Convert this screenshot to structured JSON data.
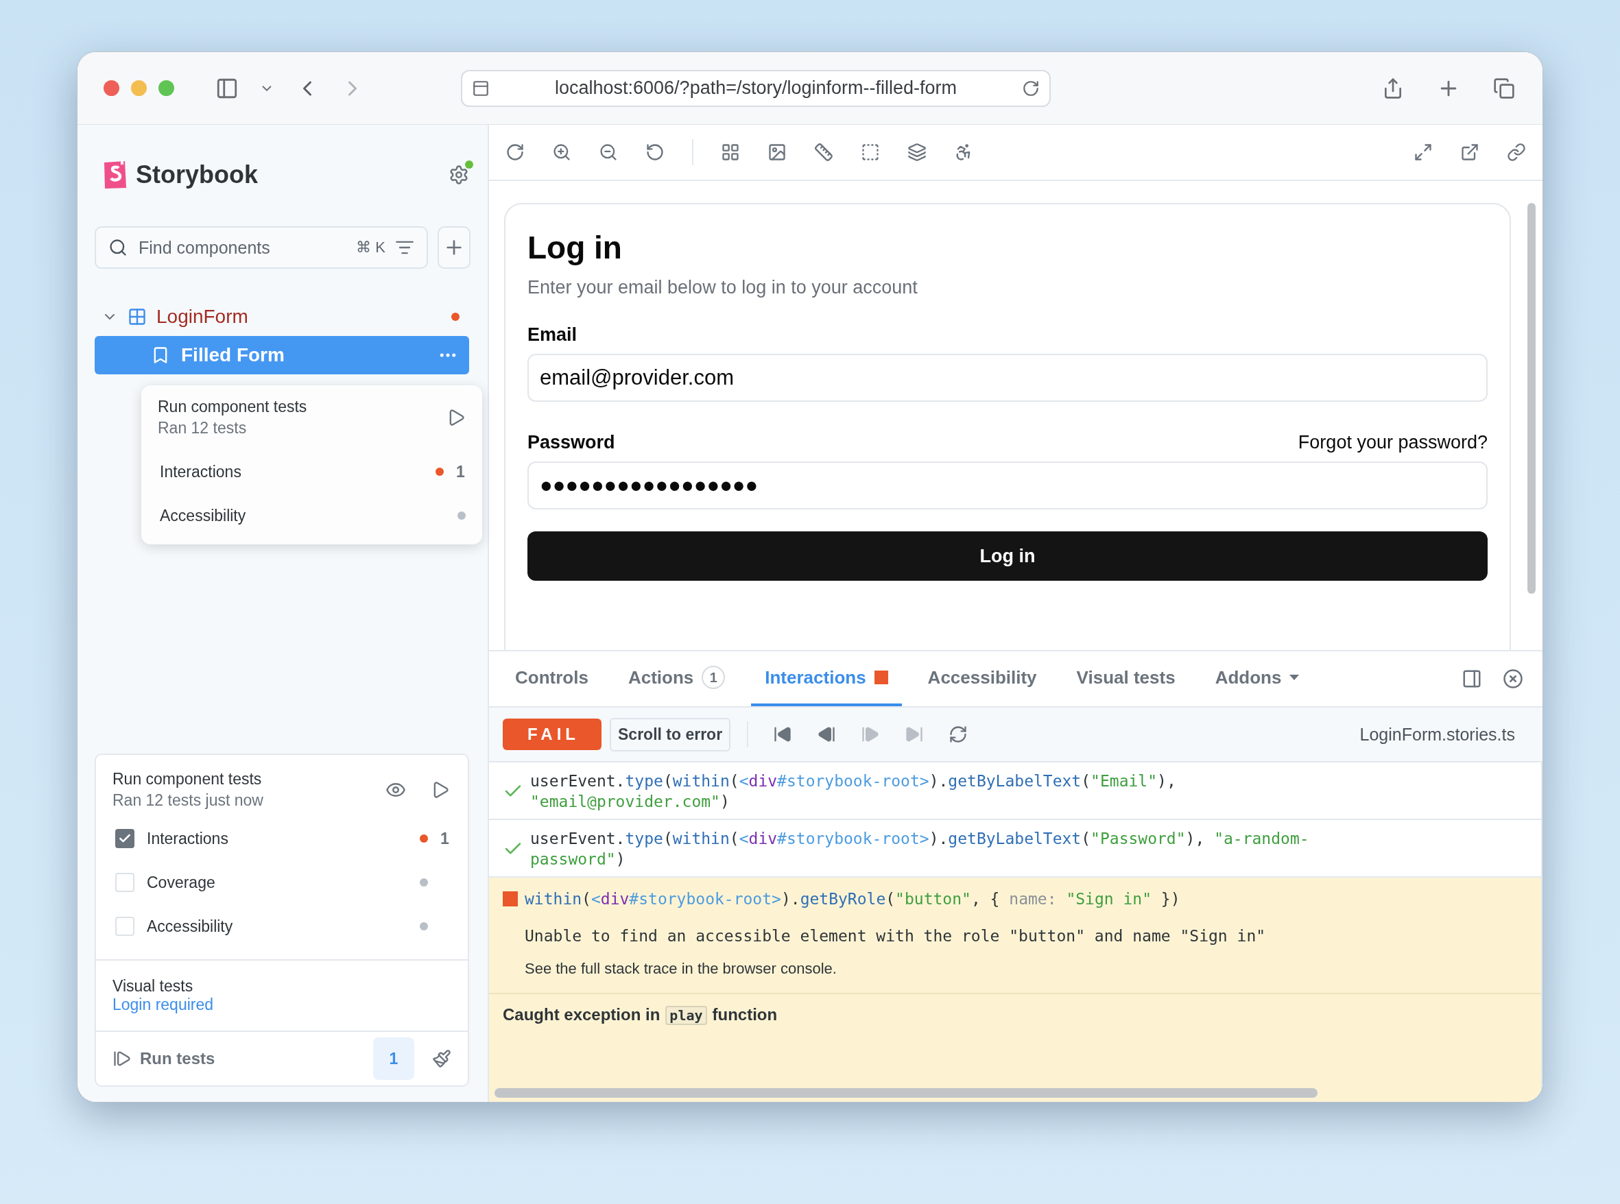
{
  "browser": {
    "url": "localhost:6006/?path=/story/loginform--filled-form"
  },
  "sidebar": {
    "brand": "Storybook",
    "search": {
      "placeholder": "Find components",
      "shortcut": "⌘ K"
    },
    "tree": [
      {
        "label": "LoginForm",
        "expanded": true,
        "color": "#e9572a",
        "children": [
          {
            "label": "Filled Form",
            "selected": true
          }
        ]
      }
    ]
  },
  "popover": {
    "title": "Run component tests",
    "subtitle": "Ran 12 tests",
    "items": [
      {
        "label": "Interactions",
        "color": "#e9572a",
        "count": "1"
      },
      {
        "label": "Accessibility",
        "color": "#b9bfc6"
      }
    ]
  },
  "testing": {
    "title": "Run component tests",
    "subtitle": "Ran 12 tests just now",
    "items": [
      {
        "label": "Interactions",
        "checked": true,
        "color": "#e9572a",
        "count": "1"
      },
      {
        "label": "Coverage",
        "checked": false,
        "color": "#b9bfc6"
      },
      {
        "label": "Accessibility",
        "checked": false,
        "color": "#b9bfc6"
      }
    ],
    "visual_title": "Visual tests",
    "visual_link": "Login required",
    "run_label": "Run tests",
    "badge": "1"
  },
  "preview": {
    "title": "Log in",
    "description": "Enter your email below to log in to your account",
    "fields": [
      {
        "label": "Email",
        "value": "email@provider.com"
      },
      {
        "label": "Password",
        "link": "Forgot your password?",
        "value": "●●●●●●●●●●●●●●●●●"
      }
    ],
    "submit": "Log in"
  },
  "addons": {
    "tabs": [
      {
        "label": "Controls",
        "selected": false
      },
      {
        "label": "Actions",
        "badge": "1",
        "selected": false
      },
      {
        "label": "Interactions",
        "selected": true,
        "color": "#e9572a"
      },
      {
        "label": "Accessibility",
        "selected": false
      },
      {
        "label": "Visual tests",
        "selected": false
      },
      {
        "label": "Addons",
        "kind": "menu",
        "selected": false
      }
    ]
  },
  "interactions": {
    "status": "FAIL",
    "scroll_button": "Scroll to error",
    "file": "LoginForm.stories.ts",
    "controls": [
      {
        "kind": "first",
        "disabled": false
      },
      {
        "kind": "back",
        "disabled": false
      },
      {
        "kind": "next",
        "disabled": true
      },
      {
        "kind": "last",
        "disabled": true
      },
      {
        "kind": "rerun",
        "disabled": false
      }
    ],
    "steps": [
      {
        "kind": "pass",
        "lines": [
          [
            {
              "text": "userEvent.",
              "kind": "plain"
            },
            {
              "text": "type",
              "kind": "fn"
            },
            {
              "text": "(",
              "kind": "plain"
            },
            {
              "text": "within",
              "kind": "fn"
            },
            {
              "text": "(",
              "kind": "plain"
            },
            {
              "text": "<",
              "kind": "ref"
            },
            {
              "text": "div",
              "kind": "tag"
            },
            {
              "text": "#storybook-root>",
              "kind": "ref"
            },
            {
              "text": ").",
              "kind": "plain"
            },
            {
              "text": "getByLabelText",
              "kind": "fn"
            },
            {
              "text": "(",
              "kind": "plain"
            },
            {
              "text": "\"Email\"",
              "kind": "str"
            },
            {
              "text": "),",
              "kind": "plain"
            }
          ],
          [
            {
              "text": "\"email@provider.com\"",
              "kind": "str"
            },
            {
              "text": ")",
              "kind": "plain"
            }
          ]
        ]
      },
      {
        "kind": "pass",
        "lines": [
          [
            {
              "text": "userEvent.",
              "kind": "plain"
            },
            {
              "text": "type",
              "kind": "fn"
            },
            {
              "text": "(",
              "kind": "plain"
            },
            {
              "text": "within",
              "kind": "fn"
            },
            {
              "text": "(",
              "kind": "plain"
            },
            {
              "text": "<",
              "kind": "ref"
            },
            {
              "text": "div",
              "kind": "tag"
            },
            {
              "text": "#storybook-root>",
              "kind": "ref"
            },
            {
              "text": ").",
              "kind": "plain"
            },
            {
              "text": "getByLabelText",
              "kind": "fn"
            },
            {
              "text": "(",
              "kind": "plain"
            },
            {
              "text": "\"Password\"",
              "kind": "str"
            },
            {
              "text": "), ",
              "kind": "plain"
            },
            {
              "text": "\"a-random-",
              "kind": "str"
            }
          ],
          [
            {
              "text": "password\"",
              "kind": "str"
            },
            {
              "text": ")",
              "kind": "plain"
            }
          ]
        ]
      },
      {
        "kind": "fail",
        "lines": [
          [
            {
              "text": "within",
              "kind": "fn"
            },
            {
              "text": "(",
              "kind": "plain"
            },
            {
              "text": "<",
              "kind": "ref"
            },
            {
              "text": "div",
              "kind": "tag"
            },
            {
              "text": "#storybook-root>",
              "kind": "ref"
            },
            {
              "text": ").",
              "kind": "plain"
            },
            {
              "text": "getByRole",
              "kind": "fn"
            },
            {
              "text": "(",
              "kind": "plain"
            },
            {
              "text": "\"button\"",
              "kind": "str"
            },
            {
              "text": ", { ",
              "kind": "plain"
            },
            {
              "text": "name:",
              "kind": "key"
            },
            {
              "text": " \"Sign in\"",
              "kind": "str"
            },
            {
              "text": " })",
              "kind": "plain"
            }
          ]
        ],
        "message": "Unable to find an accessible element with the role \"button\" and name \"Sign in\"",
        "hint": "See the full stack trace in the browser console."
      }
    ],
    "exception": {
      "before": "Caught exception in",
      "code": "play",
      "after": "function"
    }
  }
}
